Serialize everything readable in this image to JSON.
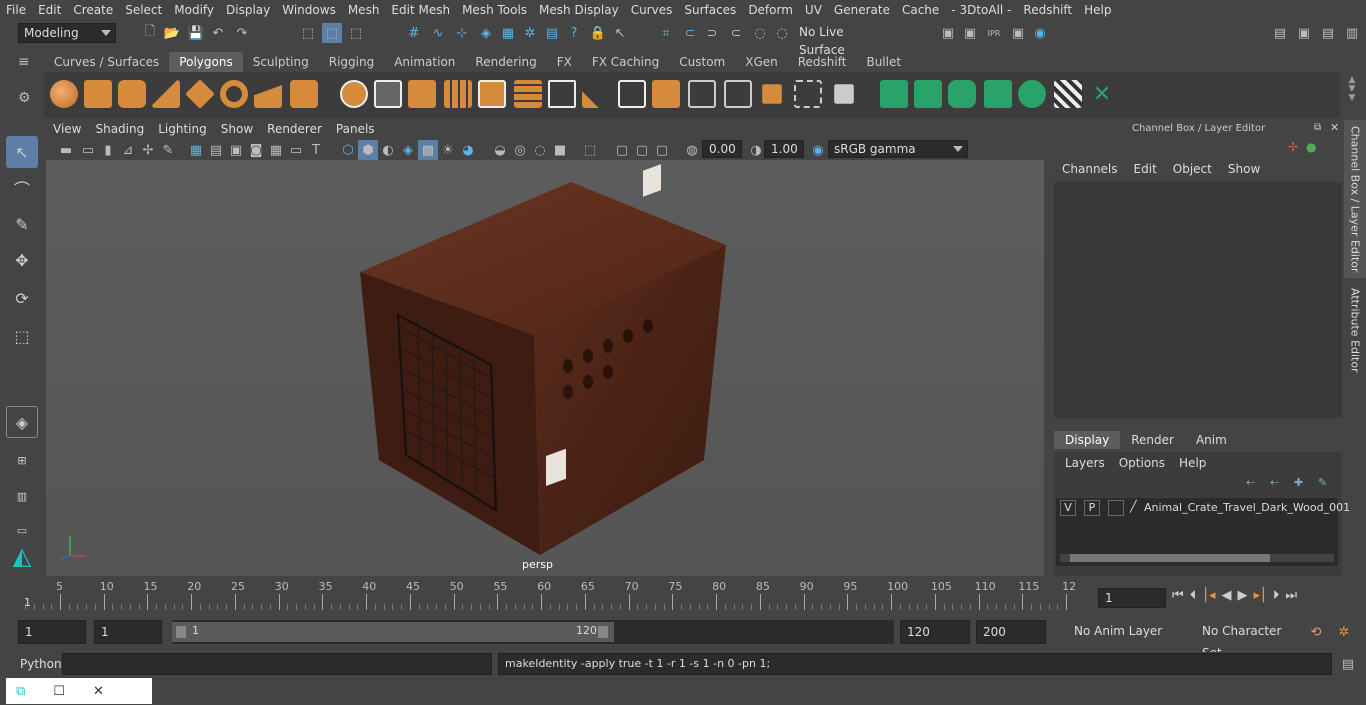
{
  "menubar": [
    "File",
    "Edit",
    "Create",
    "Select",
    "Modify",
    "Display",
    "Windows",
    "Mesh",
    "Edit Mesh",
    "Mesh Tools",
    "Mesh Display",
    "Curves",
    "Surfaces",
    "Deform",
    "UV",
    "Generate",
    "Cache",
    "- 3DtoAll -",
    "Redshift",
    "Help"
  ],
  "status": {
    "mode": "Modeling",
    "live_surface": "No Live Surface"
  },
  "shelf_tabs": [
    "Curves / Surfaces",
    "Polygons",
    "Sculpting",
    "Rigging",
    "Animation",
    "Rendering",
    "FX",
    "FX Caching",
    "Custom",
    "XGen",
    "Redshift",
    "Bullet"
  ],
  "shelf_active": "Polygons",
  "panel_menu": [
    "View",
    "Shading",
    "Lighting",
    "Show",
    "Renderer",
    "Panels"
  ],
  "panel_toolbar": {
    "exposure": "0.00",
    "gamma": "1.00",
    "colorspace": "sRGB gamma"
  },
  "viewport": {
    "camera_label": "persp"
  },
  "channel_box": {
    "title": "Channel Box / Layer Editor",
    "menu": [
      "Channels",
      "Edit",
      "Object",
      "Show"
    ],
    "tabs": [
      "Display",
      "Render",
      "Anim"
    ],
    "active_tab": "Display",
    "layer_menu": [
      "Layers",
      "Options",
      "Help"
    ],
    "layer": {
      "v": "V",
      "p": "P",
      "name": "Animal_Crate_Travel_Dark_Wood_001"
    }
  },
  "side_tabs": {
    "channel": "Channel Box / Layer Editor",
    "attribute": "Attribute Editor"
  },
  "timeline": {
    "ticks": [
      "5",
      "10",
      "15",
      "20",
      "25",
      "30",
      "35",
      "40",
      "45",
      "50",
      "55",
      "60",
      "65",
      "70",
      "75",
      "80",
      "85",
      "90",
      "95",
      "100",
      "105",
      "110",
      "115",
      "12"
    ],
    "start_label": "1",
    "current_frame": "1"
  },
  "range": {
    "start": "1",
    "playback_start": "1",
    "slider_start": "1",
    "slider_end": "120",
    "playback_end": "120",
    "end": "200",
    "anim_layer": "No Anim Layer",
    "char_set": "No Character Set"
  },
  "cmdline": {
    "lang": "Python",
    "result": "makeIdentity -apply true -t 1 -r 1 -s 1 -n 0 -pn 1;"
  }
}
